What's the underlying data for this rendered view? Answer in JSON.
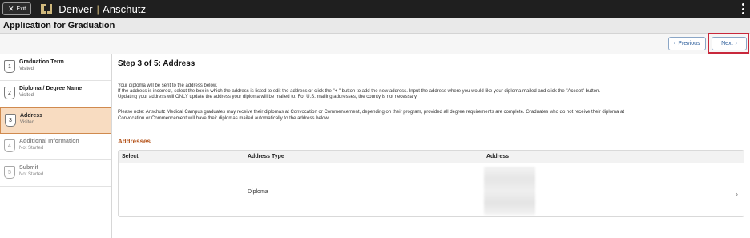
{
  "topbar": {
    "exit_label": "Exit",
    "brand_left": "Denver",
    "brand_sep": "|",
    "brand_right": "Anschutz",
    "logo_icon": "cu-logo-icon",
    "menu_icon": "kebab-menu-icon"
  },
  "page": {
    "title": "Application for Graduation"
  },
  "actions": {
    "previous_label": "Previous",
    "next_label": "Next"
  },
  "steps": [
    {
      "number": "1",
      "title": "Graduation Term",
      "status": "Visited",
      "state": "visited"
    },
    {
      "number": "2",
      "title": "Diploma / Degree Name",
      "status": "Visited",
      "state": "visited"
    },
    {
      "number": "3",
      "title": "Address",
      "status": "Visited",
      "state": "active"
    },
    {
      "number": "4",
      "title": "Additional Information",
      "status": "Not Started",
      "state": "not-started"
    },
    {
      "number": "5",
      "title": "Submit",
      "status": "Not Started",
      "state": "not-started"
    }
  ],
  "main": {
    "heading": "Step 3 of 5: Address",
    "para1_line1": "Your diploma will be sent to the address below.",
    "para1_line2": "If the address is incorrect, select the box in which the address is listed to edit the address or click the \"+ \" button to add the new address. Input the address where you would like your diploma mailed and click the \"Accept\" button.",
    "para1_line3": "Updating your address will ONLY update the address your diploma will be mailed to. For U.S. mailing addresses, the county is not necessary.",
    "para2_line1": "Please note: Anschutz Medical Campus graduates may receive their diplomas at Convocation or Commencement, depending on their program, provided all degree requirements are complete. Graduates who do not receive their diploma at",
    "para2_line2": "Convocation or Commencement will have their diplomas mailed automatically to the address below.",
    "section_label": "Addresses",
    "columns": {
      "select": "Select",
      "type": "Address Type",
      "address": "Address"
    },
    "rows": [
      {
        "type": "Diploma"
      }
    ]
  },
  "colors": {
    "topbar_bg": "#1f1f1f",
    "accent_gold": "#cfb87c",
    "active_step_bg": "#f8dcc1",
    "section_orange": "#b5541c",
    "highlight_red": "#c8283b"
  }
}
